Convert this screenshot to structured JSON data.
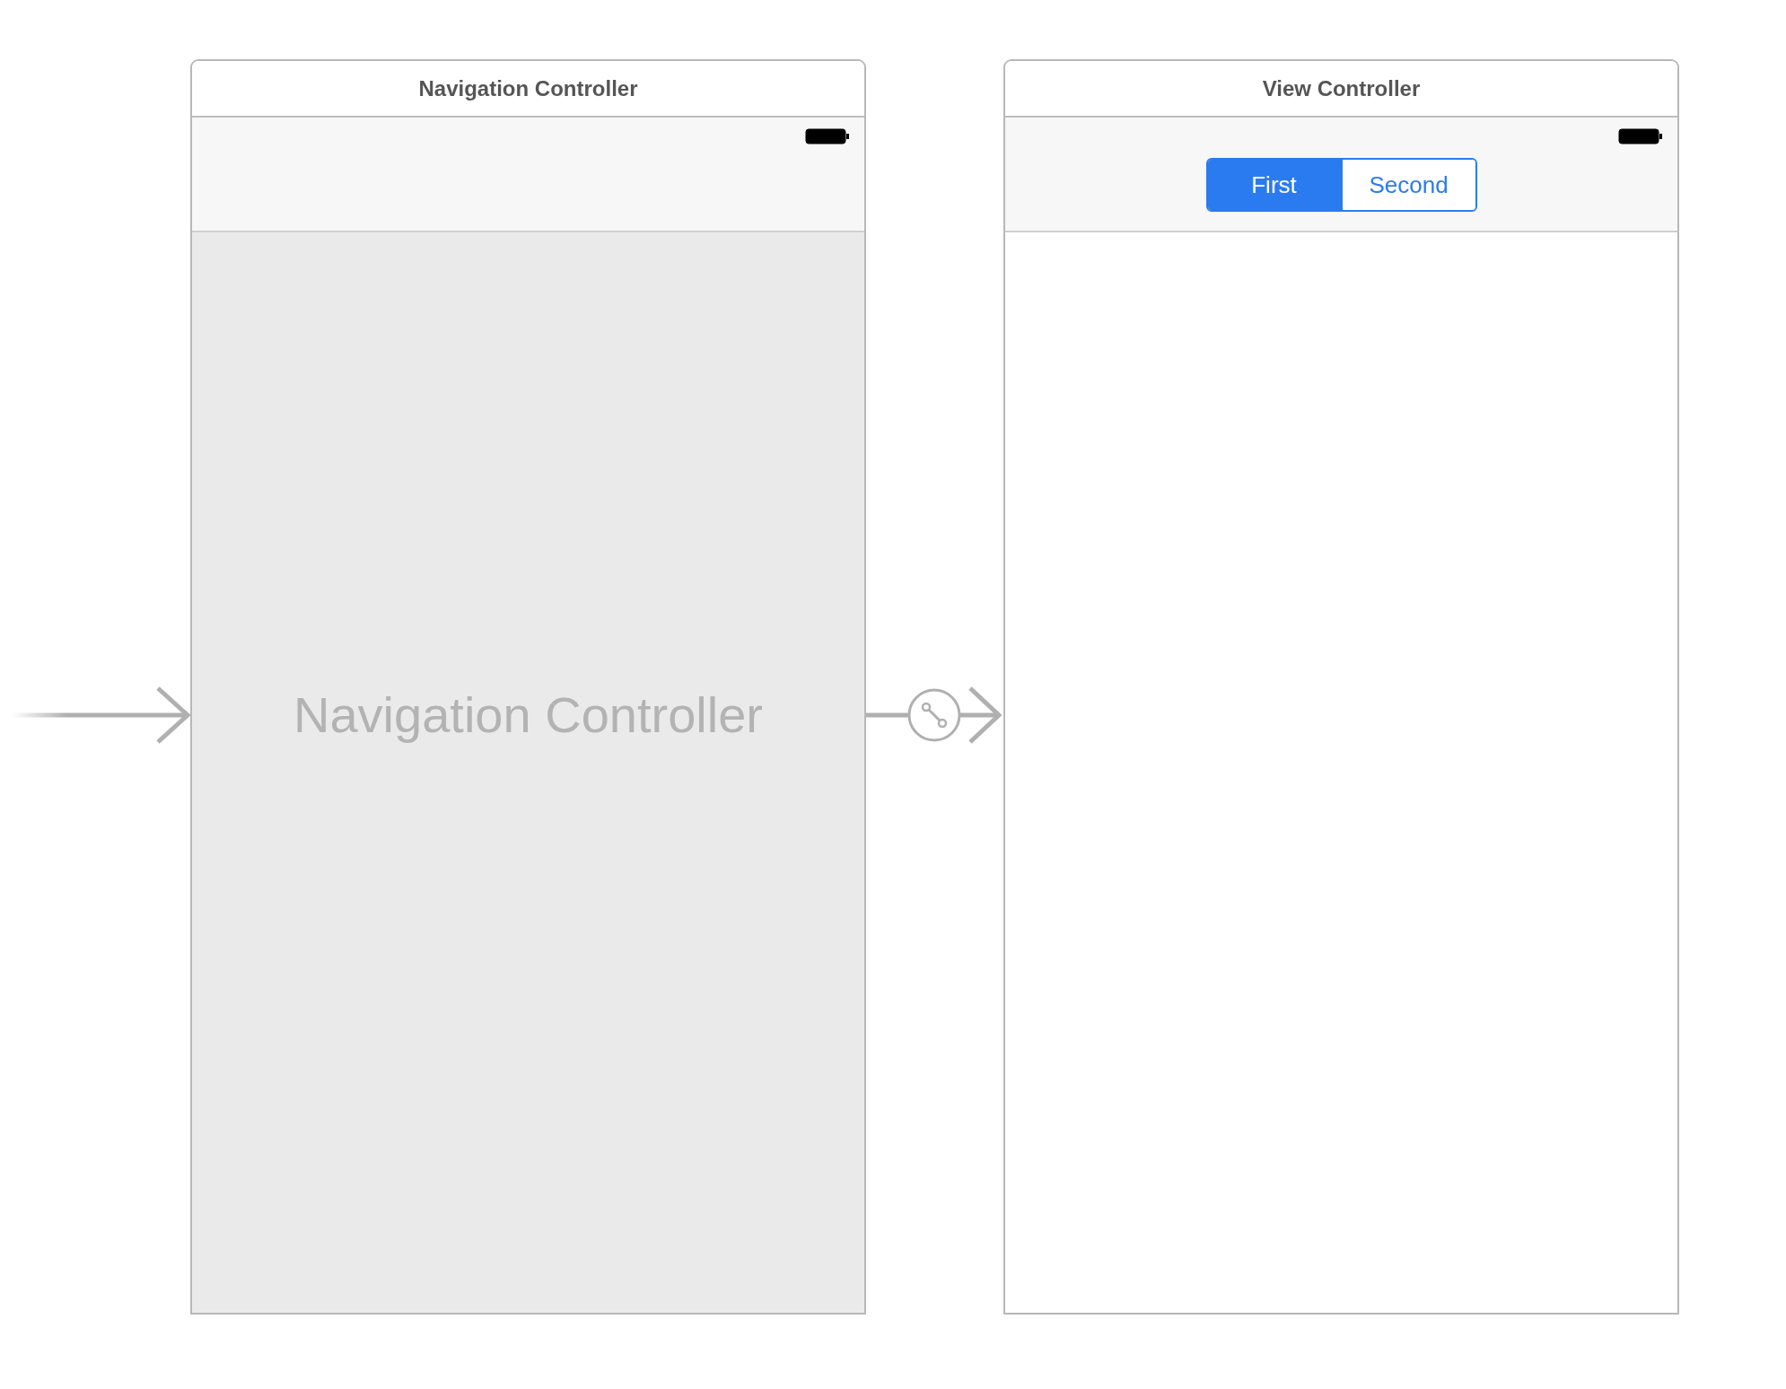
{
  "scenes": [
    {
      "kind": "navigation",
      "title": "Navigation Controller",
      "placeholder_label": "Navigation Controller"
    },
    {
      "kind": "view",
      "title": "View Controller",
      "segments": [
        {
          "label": "First",
          "selected": true
        },
        {
          "label": "Second",
          "selected": false
        }
      ]
    }
  ]
}
